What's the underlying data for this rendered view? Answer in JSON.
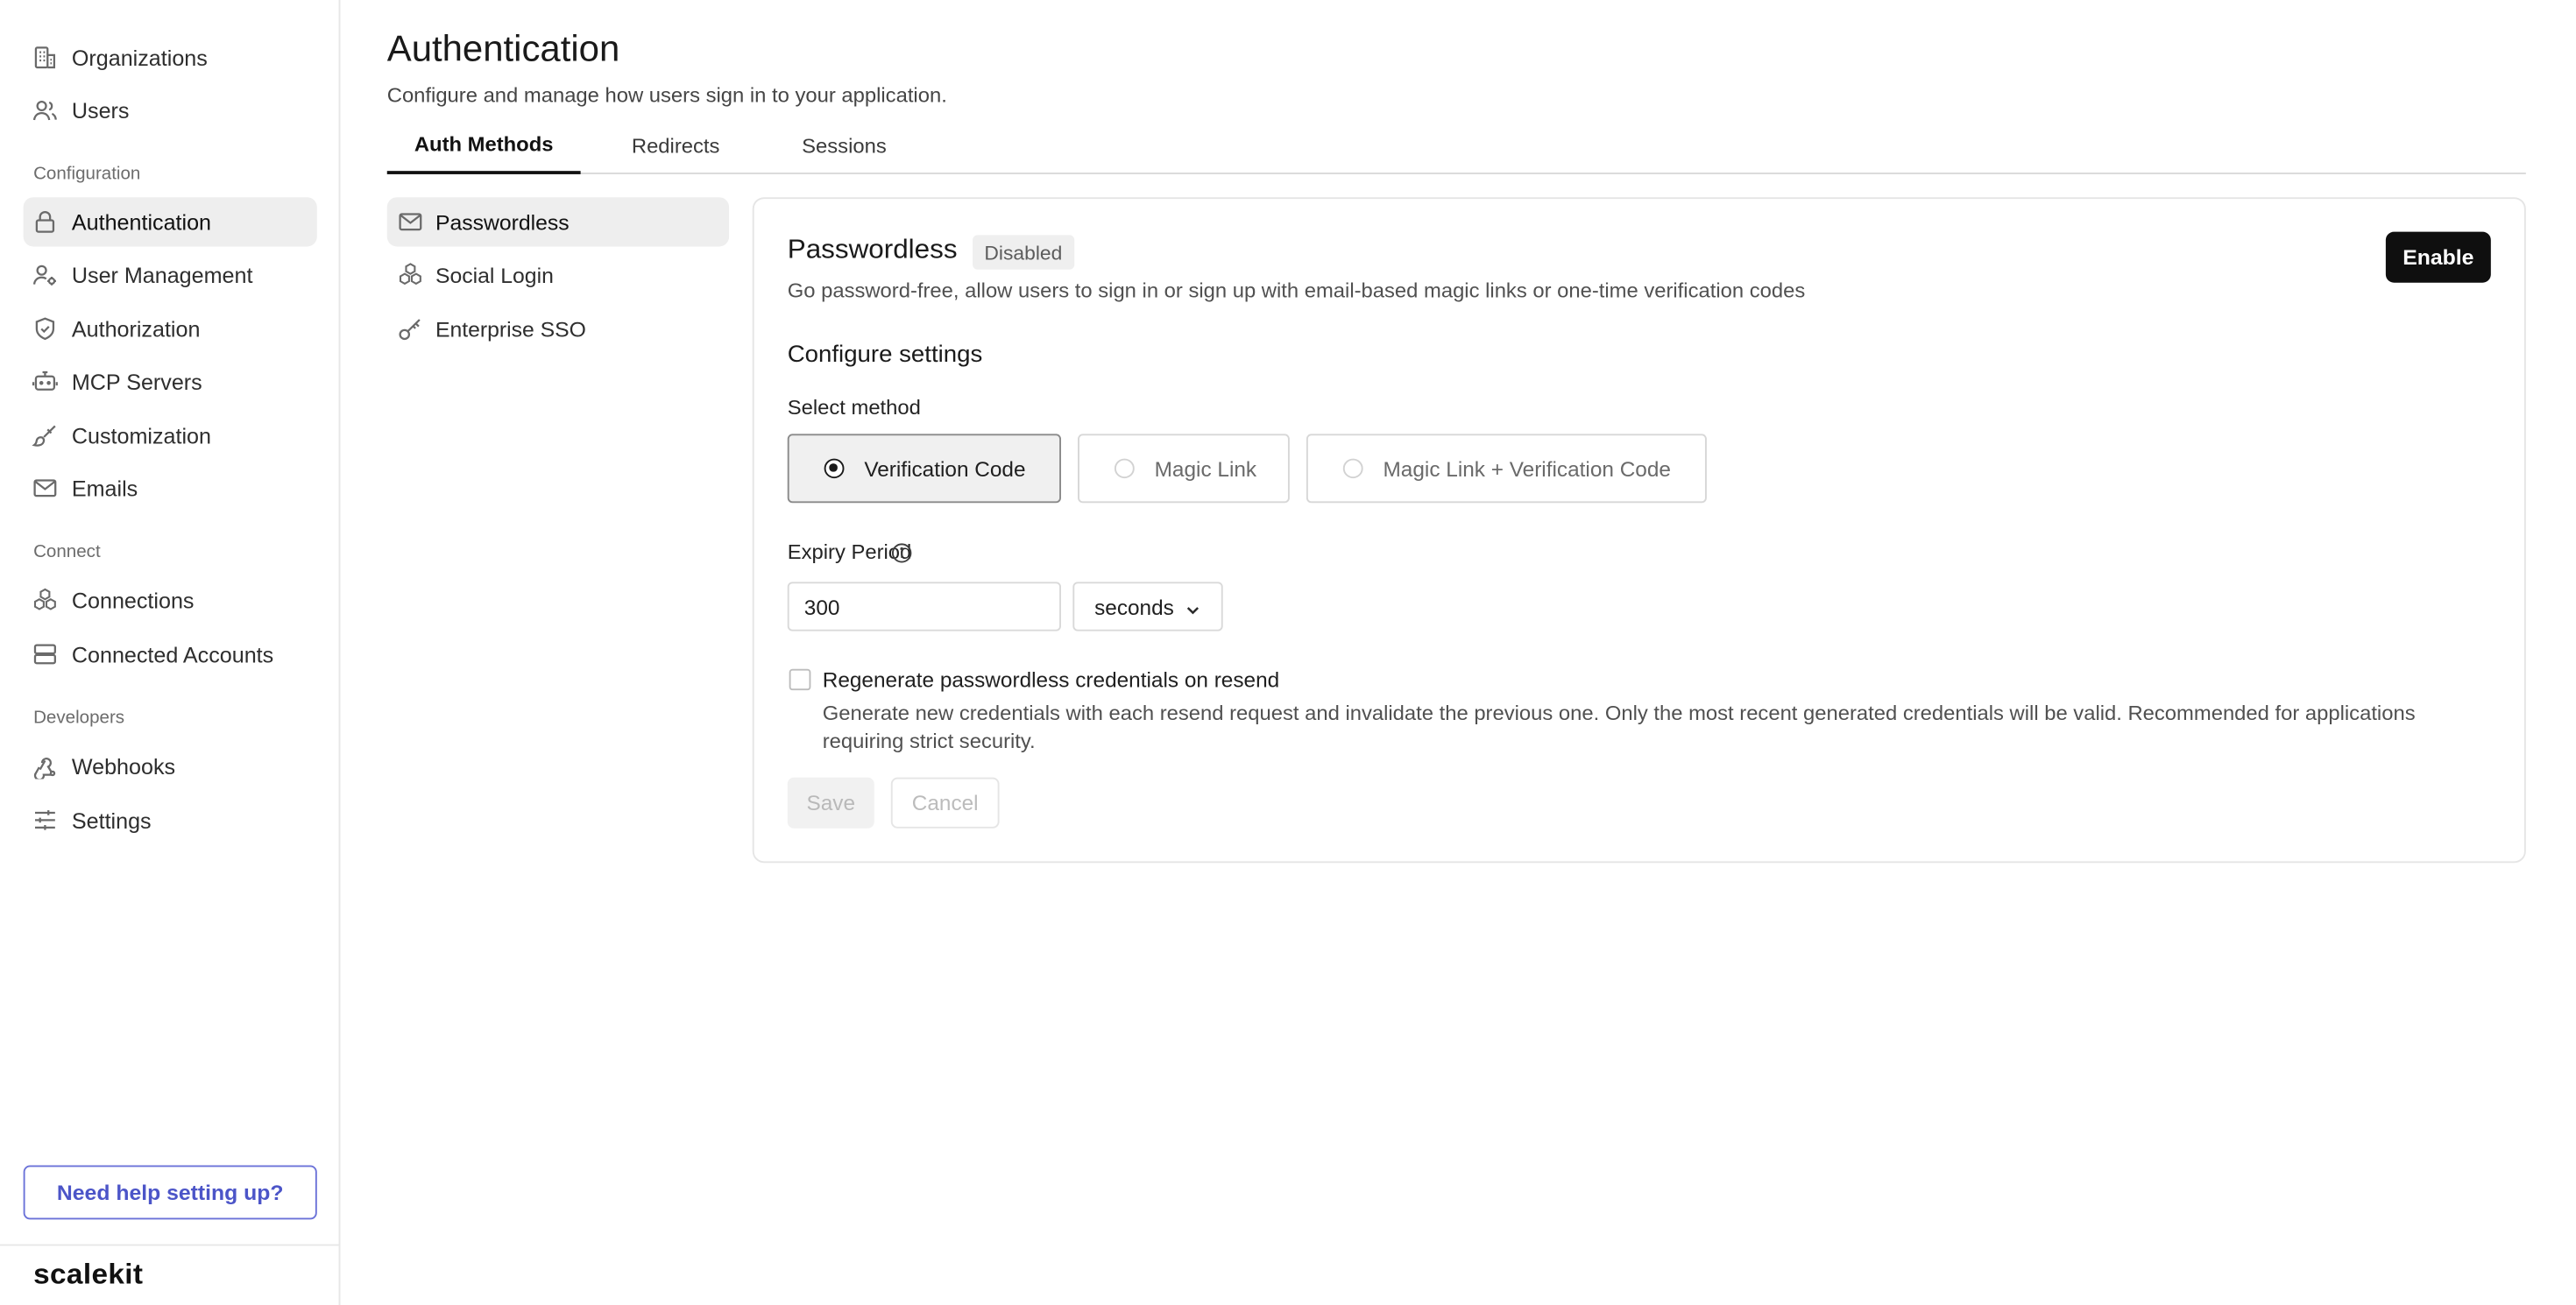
{
  "sidebar": {
    "top_items": [
      {
        "label": "Organizations",
        "icon": "building-icon"
      },
      {
        "label": "Users",
        "icon": "users-icon"
      }
    ],
    "sections": [
      {
        "label": "Configuration",
        "items": [
          {
            "label": "Authentication",
            "icon": "lock-icon",
            "active": true
          },
          {
            "label": "User Management",
            "icon": "user-cog-icon"
          },
          {
            "label": "Authorization",
            "icon": "shield-check-icon"
          },
          {
            "label": "MCP Servers",
            "icon": "robot-icon"
          },
          {
            "label": "Customization",
            "icon": "paintbrush-icon"
          },
          {
            "label": "Emails",
            "icon": "mail-icon"
          }
        ]
      },
      {
        "label": "Connect",
        "items": [
          {
            "label": "Connections",
            "icon": "cubes-icon"
          },
          {
            "label": "Connected Accounts",
            "icon": "server-icon"
          }
        ]
      },
      {
        "label": "Developers",
        "items": [
          {
            "label": "Webhooks",
            "icon": "webhook-icon"
          },
          {
            "label": "Settings",
            "icon": "sliders-icon"
          }
        ]
      }
    ],
    "help_button": "Need help setting up?",
    "logo": "scalekit"
  },
  "header": {
    "title": "Authentication",
    "subtitle": "Configure and manage how users sign in to your application."
  },
  "tabs": [
    {
      "label": "Auth Methods",
      "active": true
    },
    {
      "label": "Redirects"
    },
    {
      "label": "Sessions"
    }
  ],
  "auth_methods": [
    {
      "label": "Passwordless",
      "icon": "mail-icon",
      "active": true
    },
    {
      "label": "Social Login",
      "icon": "cubes-icon"
    },
    {
      "label": "Enterprise SSO",
      "icon": "key-icon"
    }
  ],
  "panel": {
    "title": "Passwordless",
    "status": "Disabled",
    "enable_label": "Enable",
    "description": "Go password-free, allow users to sign in or sign up with email-based magic links or one-time verification codes",
    "configure_heading": "Configure settings",
    "select_method_label": "Select method",
    "methods": [
      {
        "label": "Verification Code",
        "selected": true
      },
      {
        "label": "Magic Link",
        "selected": false
      },
      {
        "label": "Magic Link + Verification Code",
        "selected": false
      }
    ],
    "expiry_label": "Expiry Period",
    "expiry_value": "300",
    "expiry_unit": "seconds",
    "regenerate_label": "Regenerate passwordless credentials on resend",
    "regenerate_checked": false,
    "regenerate_help": "Generate new credentials with each resend request and invalidate the previous one. Only the most recent generated credentials will be valid. Recommended for applications requiring strict security.",
    "save_label": "Save",
    "cancel_label": "Cancel"
  },
  "colors": {
    "accent": "#4c55c8",
    "primary_button": "#0f0f0f",
    "active_background": "#eeeeee"
  }
}
